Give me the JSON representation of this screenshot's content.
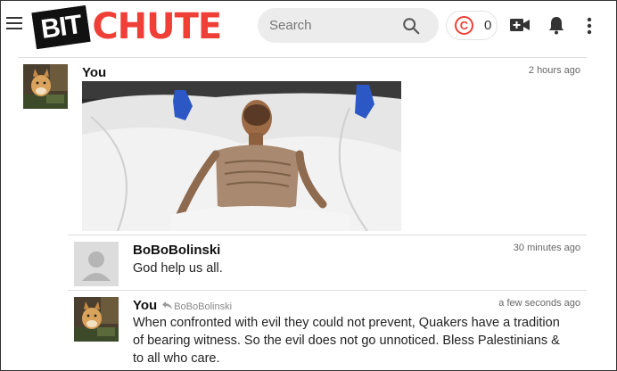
{
  "header": {
    "logo_bit": "BIT",
    "logo_chute": "CHUTE",
    "search_placeholder": "Search",
    "coin_symbol": "C",
    "coin_count": "0"
  },
  "comments": [
    {
      "author": "You",
      "time": "2 hours ago",
      "has_image": true
    },
    {
      "author": "BoBoBolinski",
      "time": "30 minutes ago",
      "text": "God help us all."
    },
    {
      "author": "You",
      "reply_to": "BoBoBolinski",
      "time": "a few seconds ago",
      "text": "When confronted with evil they could not prevent, Quakers have a tradition of bearing witness. So the evil does not go unnoticed. Bless Palestinians & to all who care."
    }
  ],
  "icons": {
    "menu": "hamburger-menu-icon",
    "search": "search-icon",
    "coin": "copyright-coin-icon",
    "upload": "video-plus-icon",
    "notifications": "bell-icon",
    "more": "more-vert-icon",
    "reply": "reply-arrow-icon"
  },
  "colors": {
    "brand_red": "#ef3f37",
    "search_bg": "#ececec",
    "divider": "#dddddd"
  }
}
